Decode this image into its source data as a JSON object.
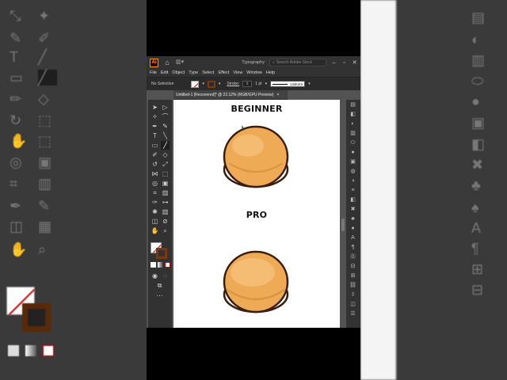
{
  "app": {
    "logo": "Ai",
    "workspace": "Typography",
    "search_placeholder": "Search Adobe Stock",
    "menus": [
      "File",
      "Edit",
      "Object",
      "Type",
      "Select",
      "Effect",
      "View",
      "Window",
      "Help"
    ]
  },
  "control_bar": {
    "selection": "No Selection",
    "stroke_label": "Stroke:",
    "stroke_value": "1 pt",
    "profile": "Uniform"
  },
  "document": {
    "tab_title": "Untitled-1 [Recovered]* @ 22.12% (RGB/GPU Preview)",
    "tab_close": "×"
  },
  "artboard": {
    "heading_top": "BEGINNER",
    "heading_bottom": "PRO"
  },
  "colors": {
    "bun": "#eeaa55",
    "bun_highlight": "#f5c37e",
    "outline": "#3a1d0c",
    "filling": "#ffffff",
    "stroke_swatch": "#7a3a10"
  }
}
